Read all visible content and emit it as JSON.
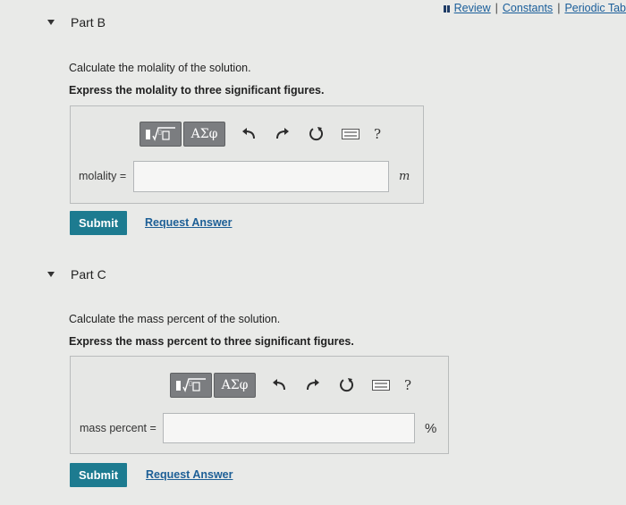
{
  "topbar": {
    "review": "Review",
    "constants": "Constants",
    "periodic": "Periodic Tab",
    "sep1": "|",
    "sep2": "|"
  },
  "parts": [
    {
      "title": "Part B",
      "question": "Calculate the molality of the solution.",
      "instruction": "Express the molality to three significant figures.",
      "field_label": "molality =",
      "field_value": "",
      "unit": "m",
      "submit": "Submit",
      "request": "Request Answer"
    },
    {
      "title": "Part C",
      "question": "Calculate the mass percent of the solution.",
      "instruction": "Express the mass percent to three significant figures.",
      "field_label": "mass percent =",
      "field_value": "",
      "unit": "%",
      "submit": "Submit",
      "request": "Request Answer"
    }
  ],
  "toolbar": {
    "greek": "ΑΣφ",
    "help": "?",
    "icons": [
      "templates-icon",
      "greek-letters-icon",
      "undo-icon",
      "redo-icon",
      "reset-icon",
      "keyboard-icon",
      "help-icon"
    ]
  }
}
